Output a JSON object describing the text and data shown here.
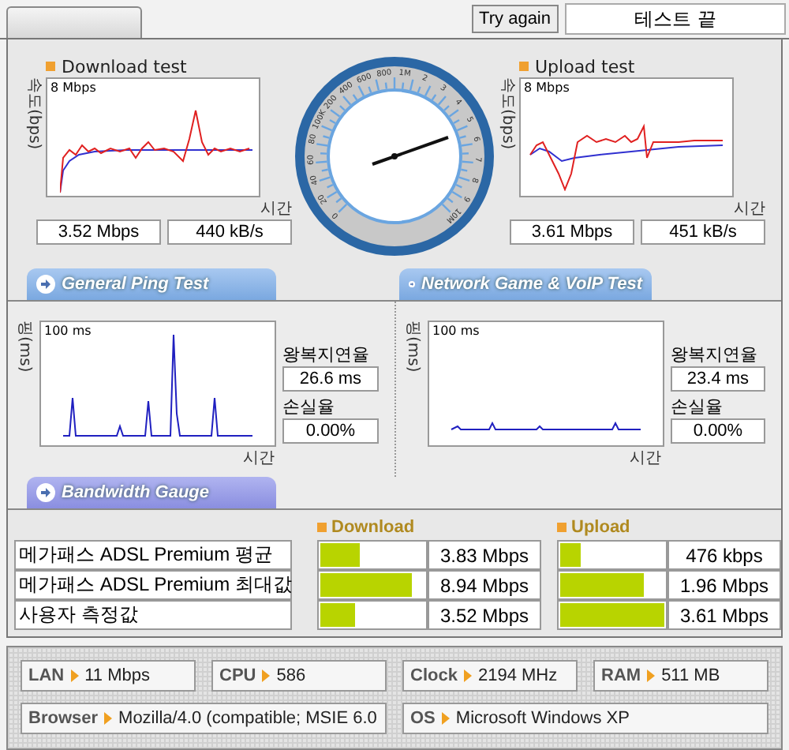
{
  "top_bar": {
    "try_again_button": "Try again",
    "status": "테스트 끝"
  },
  "speed_tests": [
    {
      "title": "Download test",
      "y_label": "속도(bps)",
      "scale": "8 Mbps",
      "x_label": "시간",
      "readouts": [
        "3.52 Mbps",
        "440 kB/s"
      ]
    },
    {
      "title": "Upload test",
      "y_label": "속도(bps)",
      "scale": "8 Mbps",
      "x_label": "시간",
      "readouts": [
        "3.61 Mbps",
        "451 kB/s"
      ]
    }
  ],
  "gauge": {
    "tick_labels": [
      "0",
      "20",
      "40",
      "60",
      "80",
      "100K",
      "200",
      "400",
      "600",
      "800",
      "1M",
      "2",
      "3",
      "4",
      "5",
      "6",
      "7",
      "8",
      "9",
      "10M"
    ]
  },
  "ping_tabs": [
    {
      "label": "General Ping Test"
    },
    {
      "label": "Network Game & VoIP Test"
    }
  ],
  "ping_tests": [
    {
      "y_label": "핑(ms)",
      "scale": "100 ms",
      "x_label": "시간",
      "latency_label": "왕복지연율",
      "latency": "26.6 ms",
      "loss_label": "손실율",
      "loss": "0.00%"
    },
    {
      "y_label": "핑(ms)",
      "scale": "100 ms",
      "x_label": "시간",
      "latency_label": "왕복지연율",
      "latency": "23.4 ms",
      "loss_label": "손실율",
      "loss": "0.00%"
    }
  ],
  "bandwidth_tab": "Bandwidth Gauge",
  "bandwidth": {
    "columns": [
      "Download",
      "Upload"
    ],
    "rows": [
      {
        "label": "메가패스 ADSL Premium 평균",
        "download": {
          "level": 0.38,
          "value": "3.83 Mbps"
        },
        "upload": {
          "level": 0.2,
          "value": "476 kbps"
        }
      },
      {
        "label": "메가패스 ADSL Premium 최대값",
        "download": {
          "level": 0.88,
          "value": "8.94 Mbps"
        },
        "upload": {
          "level": 0.8,
          "value": "1.96 Mbps"
        }
      },
      {
        "label": "사용자 측정값",
        "download": {
          "level": 0.34,
          "value": "3.52 Mbps"
        },
        "upload": {
          "level": 1.0,
          "value": "3.61 Mbps"
        }
      }
    ]
  },
  "system_info": [
    {
      "label": "LAN",
      "value": "11 Mbps"
    },
    {
      "label": "CPU",
      "value": "586"
    },
    {
      "label": "Clock",
      "value": "2194 MHz"
    },
    {
      "label": "RAM",
      "value": "511 MB"
    },
    {
      "label": "Browser",
      "value": "Mozilla/4.0 (compatible; MSIE 6.0"
    },
    {
      "label": "OS",
      "value": "Microsoft Windows XP"
    }
  ]
}
